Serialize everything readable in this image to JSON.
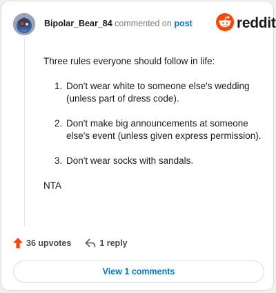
{
  "comment": {
    "username": "Bipolar_Bear_84",
    "commented_on": "commented on",
    "post_link": "post",
    "body_intro": "Three rules everyone should follow in life:",
    "rules": [
      {
        "num": "1.",
        "text": "Don't wear white to someone else's wedding (unless part of dress code)."
      },
      {
        "num": "2.",
        "text": "Don't make big announcements at someone else's event (unless given express permission)."
      },
      {
        "num": "3.",
        "text": "Don't wear socks with sandals."
      }
    ],
    "signoff": "NTA"
  },
  "brand": {
    "name": "reddit",
    "icon": "reddit-logo-icon",
    "color": "#ff4500"
  },
  "actions": {
    "upvotes": "36 upvotes",
    "upvote_icon": "upvote-arrow-icon",
    "upvote_color": "#ff4500",
    "reply": "1 reply",
    "reply_icon": "reply-arrow-icon"
  },
  "footer": {
    "view_comments": "View 1 comments"
  },
  "colors": {
    "link": "#0079d3"
  }
}
